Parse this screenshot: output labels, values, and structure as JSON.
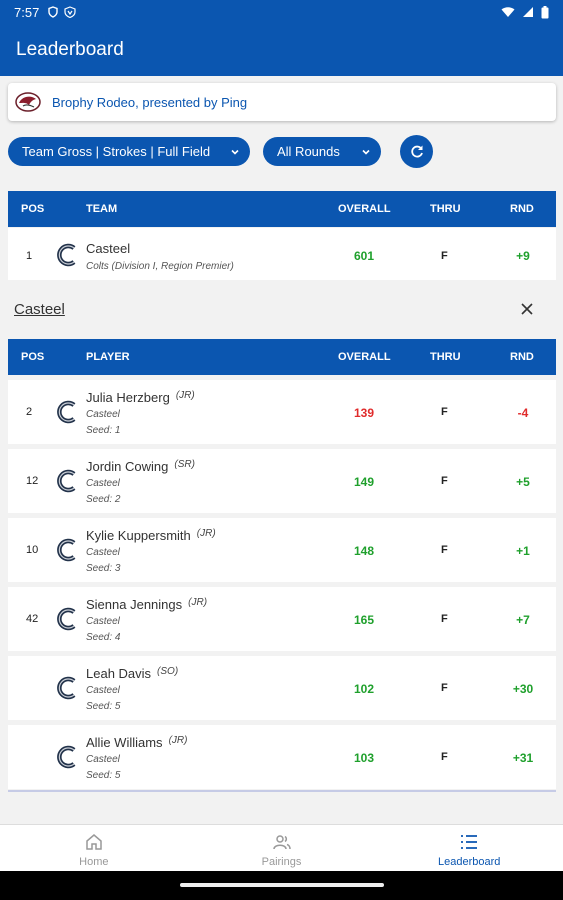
{
  "status_bar": {
    "time": "7:57"
  },
  "app_bar": {
    "title": "Leaderboard"
  },
  "event": {
    "name": "Brophy Rodeo, presented by Ping"
  },
  "filters": {
    "view": "Team Gross | Strokes | Full Field",
    "rounds": "All Rounds"
  },
  "team_table": {
    "headers": {
      "pos": "POS",
      "name": "TEAM",
      "overall": "OVERALL",
      "thru": "THRU",
      "rnd": "RND"
    },
    "rows": [
      {
        "pos": "1",
        "name": "Casteel",
        "detail": "Colts (Division I, Region Premier)",
        "overall": "601",
        "thru": "F",
        "rnd": "+9"
      }
    ]
  },
  "selected_team": {
    "name": "Casteel"
  },
  "player_table": {
    "headers": {
      "pos": "POS",
      "name": "PLAYER",
      "overall": "OVERALL",
      "thru": "THRU",
      "rnd": "RND"
    },
    "rows": [
      {
        "pos": "2",
        "name": "Julia Herzberg",
        "year": "(JR)",
        "team": "Casteel",
        "seed": "Seed: 1",
        "overall": "139",
        "thru": "F",
        "rnd": "-4",
        "under_par": true
      },
      {
        "pos": "12",
        "name": "Jordin Cowing",
        "year": "(SR)",
        "team": "Casteel",
        "seed": "Seed: 2",
        "overall": "149",
        "thru": "F",
        "rnd": "+5",
        "under_par": false
      },
      {
        "pos": "10",
        "name": "Kylie Kuppersmith",
        "year": "(JR)",
        "team": "Casteel",
        "seed": "Seed: 3",
        "overall": "148",
        "thru": "F",
        "rnd": "+1",
        "under_par": false
      },
      {
        "pos": "42",
        "name": "Sienna Jennings",
        "year": "(JR)",
        "team": "Casteel",
        "seed": "Seed: 4",
        "overall": "165",
        "thru": "F",
        "rnd": "+7",
        "under_par": false
      },
      {
        "pos": "",
        "name": "Leah Davis",
        "year": "(SO)",
        "team": "Casteel",
        "seed": "Seed: 5",
        "overall": "102",
        "thru": "F",
        "rnd": "+30",
        "under_par": false
      },
      {
        "pos": "",
        "name": "Allie Williams",
        "year": "(JR)",
        "team": "Casteel",
        "seed": "Seed: 5",
        "overall": "103",
        "thru": "F",
        "rnd": "+31",
        "under_par": false
      }
    ]
  },
  "bottom_nav": {
    "items": [
      {
        "label": "Home",
        "icon": "home-icon"
      },
      {
        "label": "Pairings",
        "icon": "people-icon"
      },
      {
        "label": "Leaderboard",
        "icon": "list-icon"
      }
    ]
  },
  "colors": {
    "primary": "#0b56b0",
    "positive": "#1fa02c",
    "negative": "#e02b2b"
  }
}
